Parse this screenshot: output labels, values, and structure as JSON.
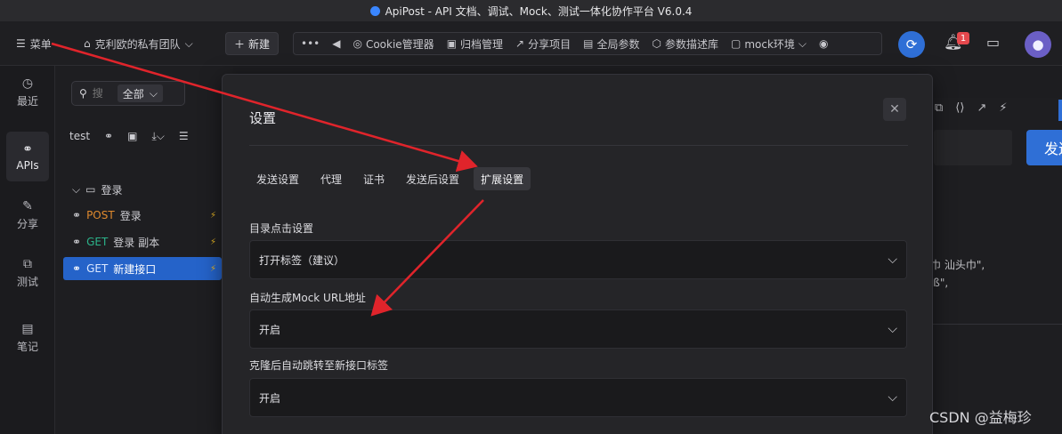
{
  "window": {
    "title": "ApiPost - API 文档、调试、Mock、测试一体化协作平台 V6.0.4"
  },
  "topbar": {
    "menu_label": "菜单",
    "team_name": "克利欧的私有团队",
    "new_label": "新建",
    "tools": [
      "Cookie管理器",
      "归档管理",
      "分享项目",
      "全局参数",
      "参数描述库",
      "mock环境"
    ],
    "notification_count": "1"
  },
  "sidebar": {
    "items": [
      {
        "label": "最近",
        "icon": "clock-icon"
      },
      {
        "label": "APIs",
        "icon": "link-icon"
      },
      {
        "label": "分享",
        "icon": "share-icon"
      },
      {
        "label": "测试",
        "icon": "flow-icon"
      },
      {
        "label": "笔记",
        "icon": "note-icon"
      }
    ]
  },
  "apipanel": {
    "search_placeholder": "搜",
    "filter_value": "全部",
    "project_name": "test",
    "tree": [
      {
        "type": "folder",
        "label": "登录"
      },
      {
        "method": "POST",
        "label": "登录"
      },
      {
        "method": "GET",
        "label": "登录 副本"
      },
      {
        "method": "GET",
        "label": "新建接口",
        "active": true
      }
    ]
  },
  "background": {
    "send_label": "发送",
    "text_line1": "巾  汕头巾\",",
    "text_line2": "'ß\","
  },
  "modal": {
    "title": "设置",
    "tabs": [
      "发送设置",
      "代理",
      "证书",
      "发送后设置",
      "扩展设置"
    ],
    "active_tab": "扩展设置",
    "fields": [
      {
        "label": "目录点击设置",
        "value": "打开标签（建议）"
      },
      {
        "label": "自动生成Mock URL地址",
        "value": "开启"
      },
      {
        "label": "克隆后自动跳转至新接口标签",
        "value": "开启"
      }
    ]
  },
  "watermark": "CSDN @益梅珍",
  "colors": {
    "accent": "#2f6fd6",
    "annotation": "#e0242b",
    "post": "#e08a2e",
    "get": "#2bb38a"
  }
}
